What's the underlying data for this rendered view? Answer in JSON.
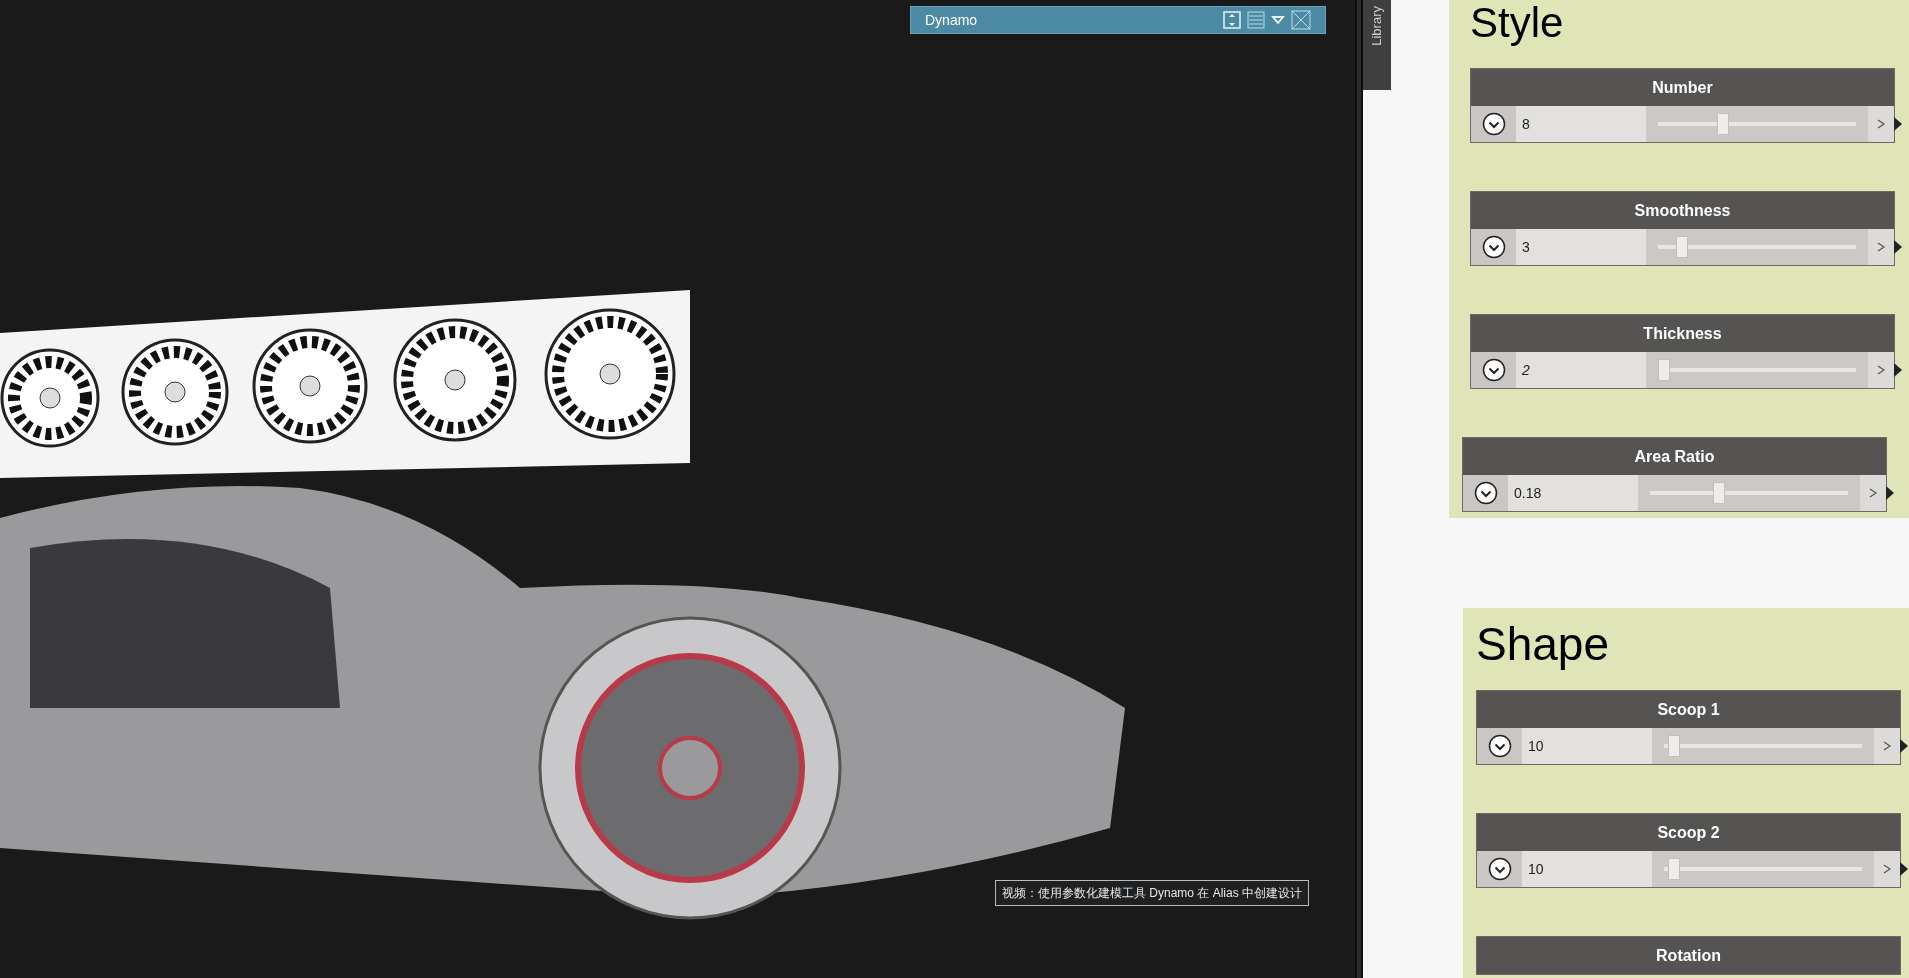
{
  "viewport": {
    "panel": {
      "title": "Dynamo"
    },
    "caption": "视频：使用参数化建模工具 Dynamo 在 Alias 中创建设计"
  },
  "library_tab": {
    "label": "Library"
  },
  "groups": [
    {
      "title": "Style",
      "nodes": [
        {
          "title": "Number",
          "value": "8",
          "level": 0.33,
          "italic": false
        },
        {
          "title": "Smoothness",
          "value": "3",
          "level": 0.12,
          "italic": false
        },
        {
          "title": "Thickness",
          "value": "2",
          "level": 0.03,
          "italic": true
        },
        {
          "title": "Area Ratio",
          "value": "0.18",
          "level": 0.35,
          "italic": false
        }
      ]
    },
    {
      "title": "Shape",
      "nodes": [
        {
          "title": "Scoop 1",
          "value": "10",
          "level": 0.05,
          "italic": false
        },
        {
          "title": "Scoop 2",
          "value": "10",
          "level": 0.05,
          "italic": false
        },
        {
          "title": "Rotation"
        }
      ]
    }
  ]
}
